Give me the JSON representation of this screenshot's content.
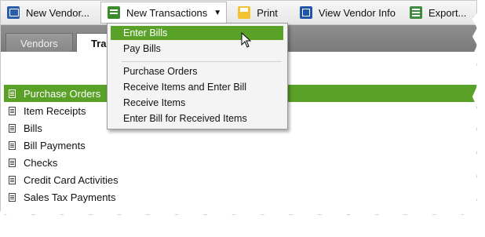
{
  "toolbar": {
    "items": [
      {
        "label": "New Vendor...",
        "icon": "vendor-icon"
      },
      {
        "label": "New Transactions",
        "icon": "transactions-icon",
        "has_dropdown": true
      },
      {
        "label": "Print",
        "icon": "print-icon"
      },
      {
        "label": "View Vendor Info",
        "icon": "vendor-info-icon"
      },
      {
        "label": "Export...",
        "icon": "export-icon"
      }
    ]
  },
  "tabs": [
    {
      "label": "Vendors",
      "active": false
    },
    {
      "label": "Trans",
      "active": true
    }
  ],
  "menu": {
    "items": [
      {
        "label": "Enter Bills",
        "highlighted": true
      },
      {
        "label": "Pay Bills"
      },
      {
        "label": "Purchase Orders"
      },
      {
        "label": "Receive Items and Enter Bill"
      },
      {
        "label": "Receive Items"
      },
      {
        "label": "Enter Bill for Received Items"
      }
    ]
  },
  "transaction_list": [
    {
      "label": "Purchase Orders",
      "selected": true
    },
    {
      "label": "Item Receipts"
    },
    {
      "label": "Bills"
    },
    {
      "label": "Bill Payments"
    },
    {
      "label": "Checks"
    },
    {
      "label": "Credit Card Activities"
    },
    {
      "label": "Sales Tax Payments"
    }
  ],
  "colors": {
    "selection_green": "#5aa128",
    "tab_bar_gray": "#7a7a7a"
  }
}
